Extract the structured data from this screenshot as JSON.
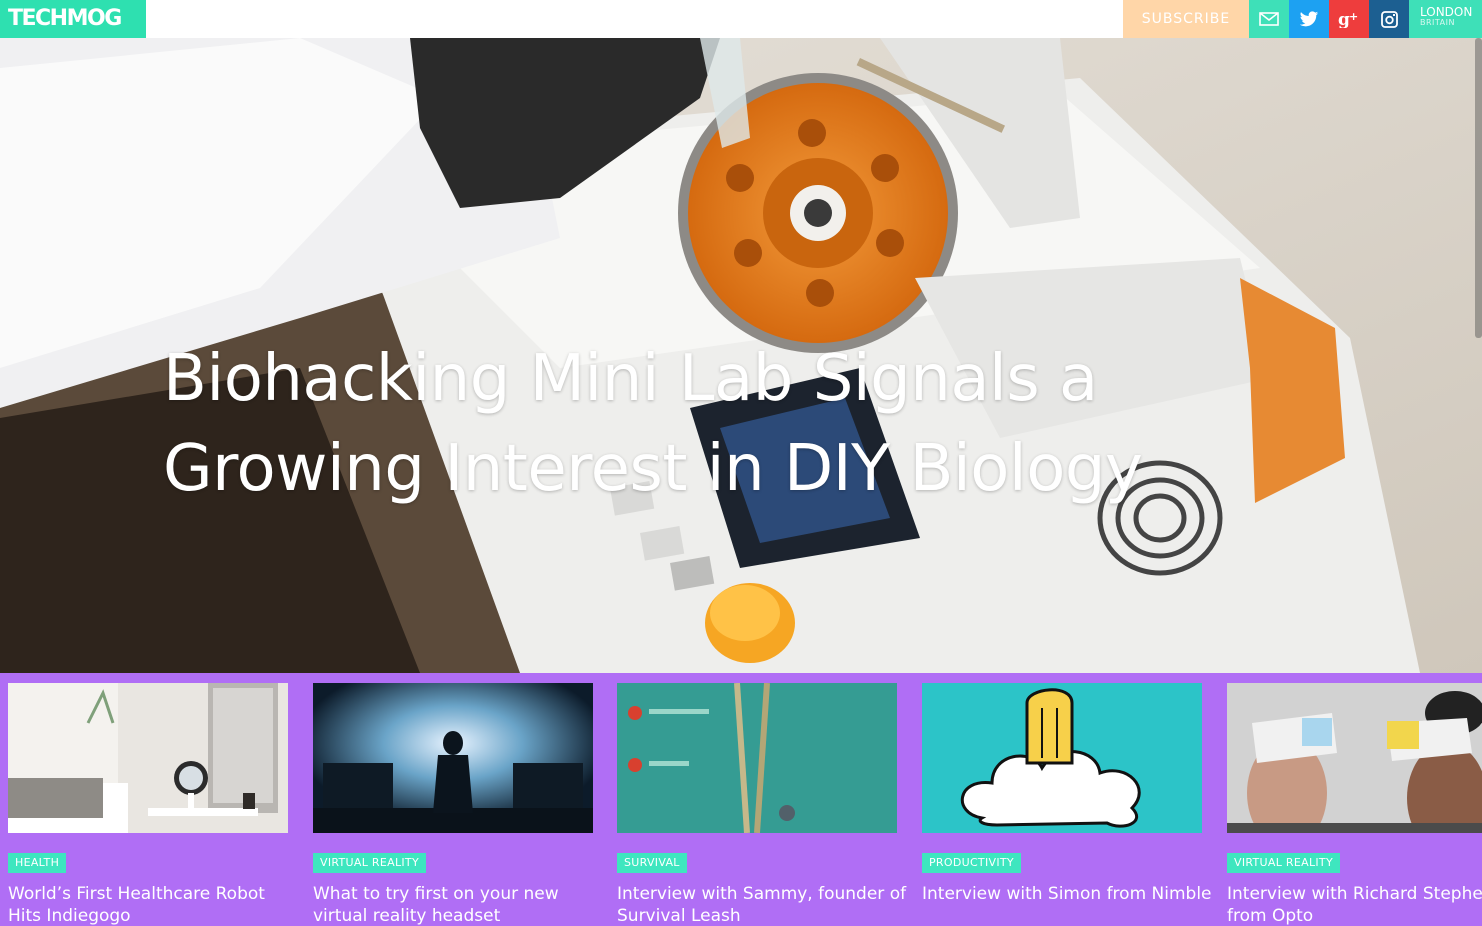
{
  "site": {
    "logo": "TECHMOG",
    "subscribe_label": "SUBSCRIBE",
    "location_city": "LONDON",
    "location_country": "BRITAIN"
  },
  "social": [
    {
      "icon": "mail-icon",
      "color": "#3ee0b8"
    },
    {
      "icon": "twitter-icon",
      "color": "#1da1f2"
    },
    {
      "icon": "google-plus-icon",
      "color": "#ee3d3d"
    },
    {
      "icon": "instagram-icon",
      "color": "#1c5f91"
    }
  ],
  "hero": {
    "title": "Biohacking Mini Lab Signals a Growing Interest in DIY Biology"
  },
  "cards": [
    {
      "tag": "HEALTH",
      "title": "World’s First Healthcare Robot Hits Indiegogo"
    },
    {
      "tag": "VIRTUAL REALITY",
      "title": "What to try first on your new virtual reality headset"
    },
    {
      "tag": "SURVIVAL",
      "title": "Interview with Sammy, founder of Survival Leash"
    },
    {
      "tag": "PRODUCTIVITY",
      "title": "Interview with Simon from Nimble"
    },
    {
      "tag": "VIRTUAL REALITY",
      "title": "Interview with Richard Stephens from Opto"
    }
  ],
  "colors": {
    "logo_bg": "#2ee0b0",
    "subscribe_bg": "#ffd6a8",
    "location_bg": "#3ee0b8",
    "strip_bg": "#b06ef5",
    "tag_bg": "#3ee6bf"
  }
}
